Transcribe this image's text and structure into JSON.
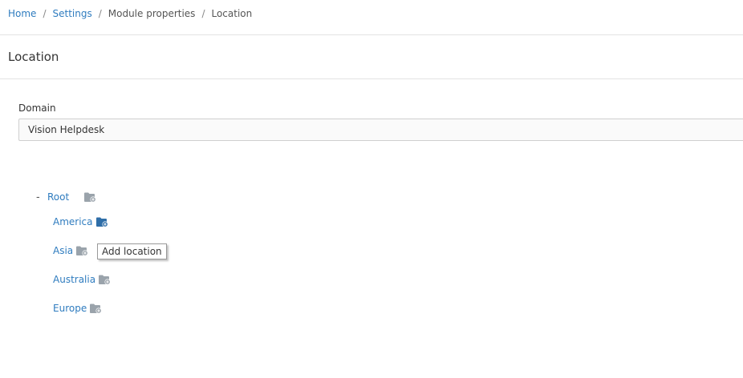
{
  "breadcrumb": {
    "home": "Home",
    "settings": "Settings",
    "module_properties": "Module properties",
    "current": "Location",
    "separator": "/"
  },
  "page": {
    "title": "Location"
  },
  "domain": {
    "label": "Domain",
    "value": "Vision Helpdesk"
  },
  "tree": {
    "root": {
      "toggle": "-",
      "label": "Root"
    },
    "children": [
      {
        "label": "America",
        "add_icon_active": true
      },
      {
        "label": "Asia",
        "add_icon_active": false
      },
      {
        "label": "Australia",
        "add_icon_active": false
      },
      {
        "label": "Europe",
        "add_icon_active": false
      }
    ]
  },
  "tooltip": {
    "text": "Add location"
  },
  "colors": {
    "link": "#2f7cbf",
    "icon_gray": "#9aa3ab",
    "icon_active": "#2f6ea8"
  }
}
